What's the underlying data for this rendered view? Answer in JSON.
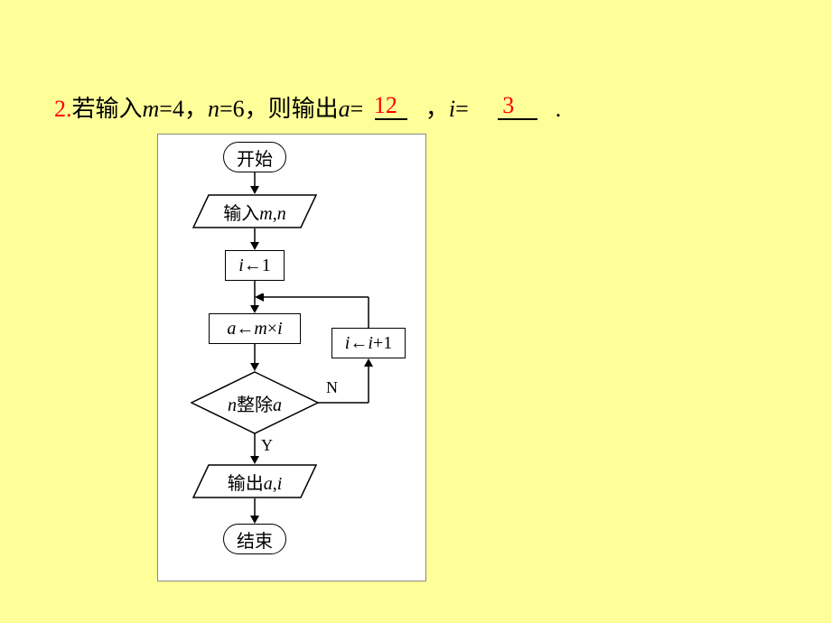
{
  "question": {
    "number": "2.",
    "pre_text": "若输入",
    "m_label": "m",
    "m_val": "=4，",
    "n_label": "n",
    "n_val": "=6，则输出",
    "a_label": "a",
    "eq1": "=",
    "answer_a": "12",
    "sep1": "，",
    "i_label": "i",
    "eq2": "=",
    "answer_i": "3",
    "period": "."
  },
  "flowchart": {
    "start": "开始",
    "input": "输入m,n",
    "init_i": "i←1",
    "calc_a": "a←m×i",
    "inc_i": "i←i+1",
    "decision": "n整除a",
    "yes": "Y",
    "no": "N",
    "output": "输出a,i",
    "end": "结束"
  },
  "chart_data": {
    "type": "flowchart",
    "nodes": [
      {
        "id": "start",
        "type": "terminal",
        "label": "开始"
      },
      {
        "id": "input",
        "type": "io",
        "label": "输入m,n"
      },
      {
        "id": "init",
        "type": "process",
        "label": "i←1"
      },
      {
        "id": "calc",
        "type": "process",
        "label": "a←m×i"
      },
      {
        "id": "dec",
        "type": "decision",
        "label": "n整除a"
      },
      {
        "id": "inc",
        "type": "process",
        "label": "i←i+1"
      },
      {
        "id": "output",
        "type": "io",
        "label": "输出a,i"
      },
      {
        "id": "end",
        "type": "terminal",
        "label": "结束"
      }
    ],
    "edges": [
      {
        "from": "start",
        "to": "input"
      },
      {
        "from": "input",
        "to": "init"
      },
      {
        "from": "init",
        "to": "calc"
      },
      {
        "from": "calc",
        "to": "dec"
      },
      {
        "from": "dec",
        "to": "output",
        "label": "Y"
      },
      {
        "from": "dec",
        "to": "inc",
        "label": "N"
      },
      {
        "from": "inc",
        "to": "calc"
      },
      {
        "from": "output",
        "to": "end"
      }
    ],
    "trace": {
      "m": 4,
      "n": 6,
      "result_a": 12,
      "result_i": 3
    }
  }
}
